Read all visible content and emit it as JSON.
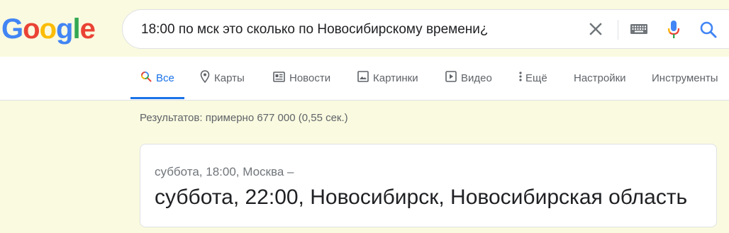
{
  "logo": {
    "letters": [
      "G",
      "o",
      "o",
      "g",
      "l",
      "e"
    ],
    "colors": [
      "#4285f4",
      "#ea4335",
      "#fbbc05",
      "#4285f4",
      "#34a853",
      "#ea4335"
    ]
  },
  "search": {
    "query": "18:00 по мск это сколько по Новосибирскому времени¿"
  },
  "icons": {
    "clear": "close-icon",
    "keyboard": "keyboard-icon",
    "mic": "microphone-icon",
    "search": "search-icon"
  },
  "tabs": [
    {
      "label": "Все",
      "icon": "search-icon",
      "active": true
    },
    {
      "label": "Карты",
      "icon": "map-pin-icon"
    },
    {
      "label": "Новости",
      "icon": "newspaper-icon"
    },
    {
      "label": "Картинки",
      "icon": "image-icon"
    },
    {
      "label": "Видео",
      "icon": "video-icon"
    },
    {
      "label": "Ещё",
      "icon": "more-vertical-icon"
    },
    {
      "label": "Настройки"
    },
    {
      "label": "Инструменты"
    }
  ],
  "results": {
    "count_text": "Результатов: примерно 677 000 (0,55 сек.)"
  },
  "answer": {
    "from_text": "суббота, 18:00, Москва –",
    "to_text": "суббота, 22:00, Новосибирск, Новосибирская область"
  },
  "colors": {
    "accent": "#1a73e8",
    "background": "#fafae0",
    "text_muted": "#5f6368"
  }
}
